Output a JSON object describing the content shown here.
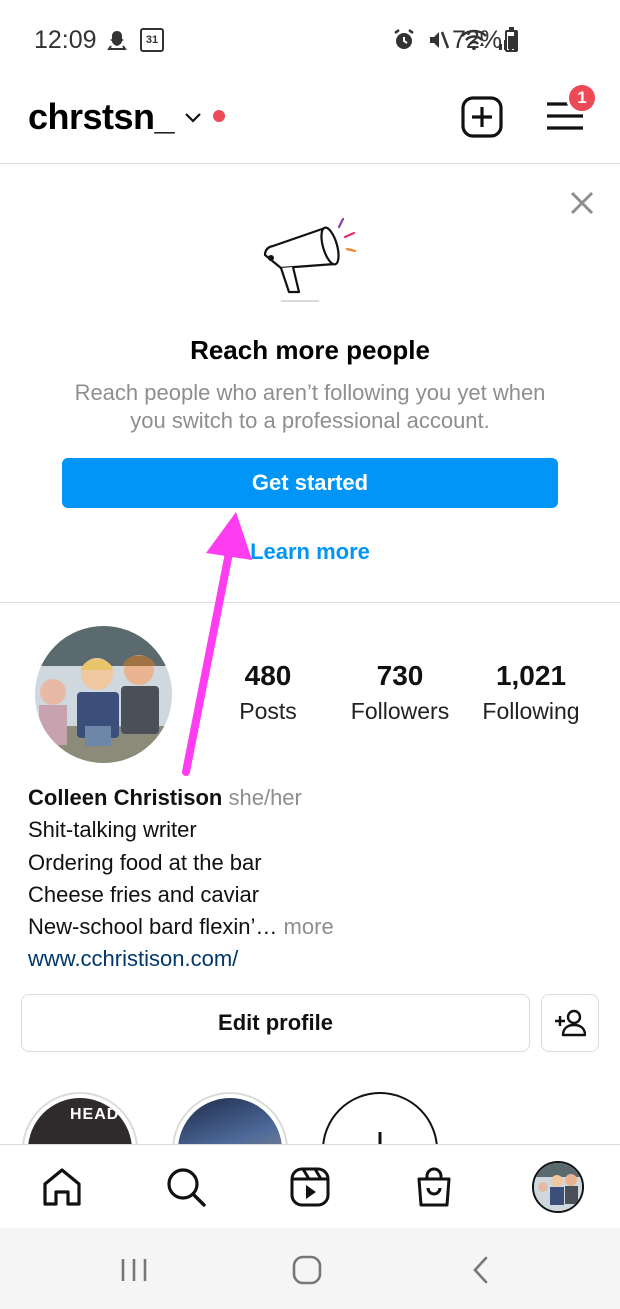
{
  "status_bar": {
    "time": "12:09",
    "battery": "72%",
    "battery_level": 0.72,
    "calendar_day": "31"
  },
  "header": {
    "username": "chrstsn_",
    "notification_count": "1"
  },
  "promo": {
    "title": "Reach more people",
    "description": "Reach people who aren’t following you yet when you switch to a professional account.",
    "cta_label": "Get started",
    "link_label": "Learn more"
  },
  "profile": {
    "stats": [
      {
        "value": "480",
        "label": "Posts"
      },
      {
        "value": "730",
        "label": "Followers"
      },
      {
        "value": "1,021",
        "label": "Following"
      }
    ],
    "name": "Colleen Christison",
    "pronouns": "she/her",
    "bio_lines": [
      "Shit-talking writer",
      "Ordering food at the bar",
      "Cheese fries and caviar",
      "New-school bard flexin’…"
    ],
    "more_label": " more",
    "website": "www.cchristison.com/",
    "edit_label": "Edit profile"
  },
  "highlights": [
    {
      "label": "HEAD"
    }
  ],
  "colors": {
    "accent": "#0095f6",
    "badge": "#ed4956",
    "annotation_arrow": "#ff3df0",
    "link": "#00376b",
    "muted": "#8e8e8e"
  },
  "icons": {
    "header": [
      "chevron-down-icon",
      "new-post-icon",
      "menu-icon"
    ],
    "nav": [
      "home-icon",
      "search-icon",
      "reels-icon",
      "shop-icon",
      "profile-avatar"
    ],
    "android": [
      "recents-icon",
      "home-circle-icon",
      "back-icon"
    ]
  }
}
